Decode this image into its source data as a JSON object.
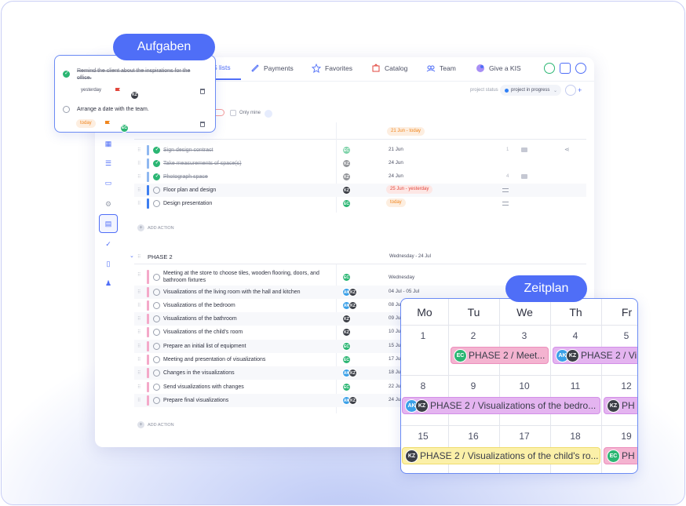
{
  "nav": {
    "items": [
      {
        "label": "S lists",
        "icon": "list-icon"
      },
      {
        "label": "Payments",
        "icon": "payments-icon"
      },
      {
        "label": "Favorites",
        "icon": "star-icon"
      },
      {
        "label": "Catalog",
        "icon": "catalog-icon"
      },
      {
        "label": "Team",
        "icon": "team-icon"
      },
      {
        "label": "Give a KIS",
        "icon": "kis-icon"
      }
    ]
  },
  "project": {
    "status_label": "project status",
    "status_value": "project in progress"
  },
  "filters": {
    "only_mine": "Only mine"
  },
  "phase1": {
    "header_date": "21 Jun - today",
    "rows": [
      {
        "title": "Sign design contract",
        "done": true,
        "avatars": [
          "EC"
        ],
        "date": "21 Jun",
        "bar": "#8fb8f0"
      },
      {
        "title": "Take measurements of space(s)",
        "done": true,
        "avatars": [
          "KZ"
        ],
        "date": "24 Jun",
        "bar": "#8fb8f0"
      },
      {
        "title": "Photograph space",
        "done": true,
        "avatars": [
          "KZ"
        ],
        "date": "24 Jun",
        "bar": "#8fb8f0"
      },
      {
        "title": "Floor plan and design",
        "done": false,
        "avatars": [
          "KZ"
        ],
        "date": "25 Jun - yesterday",
        "bar": "#3d7ef0"
      },
      {
        "title": "Design presentation",
        "done": false,
        "avatars": [
          "EC"
        ],
        "date": "today",
        "bar": "#3d7ef0"
      }
    ],
    "comment_counts": [
      "1",
      "4"
    ],
    "add_action": "ADD ACTION"
  },
  "phase2": {
    "name": "PHASE 2",
    "date": "Wednesday - 24 Jul",
    "rows": [
      {
        "title": "Meeting at the store to choose tiles, wooden flooring, doors, and bathroom fixtures",
        "avatars": [
          "EC"
        ],
        "date": "Wednesday"
      },
      {
        "title": "Visualizations of the living room with the hall and kitchen",
        "avatars": [
          "AK",
          "KZ"
        ],
        "date": "04 Jul - 05 Jul"
      },
      {
        "title": "Visualizations of the bedroom",
        "avatars": [
          "AK",
          "KZ"
        ],
        "date": "08 Ju"
      },
      {
        "title": "Visualizations of the bathroom",
        "avatars": [
          "KZ"
        ],
        "date": "09 Ju"
      },
      {
        "title": "Visualizations of the child's room",
        "avatars": [
          "KZ"
        ],
        "date": "10 Ju"
      },
      {
        "title": "Prepare an initial list of equipment",
        "avatars": [
          "EC"
        ],
        "date": "15 Ju"
      },
      {
        "title": "Meeting and presentation of visualizations",
        "avatars": [
          "EC"
        ],
        "date": "17 Ju"
      },
      {
        "title": "Changes in the visualizations",
        "avatars": [
          "AK",
          "KZ"
        ],
        "date": "18 Ju"
      },
      {
        "title": "Send visualizations with changes",
        "avatars": [
          "EC"
        ],
        "date": "22 Ju"
      },
      {
        "title": "Prepare final visualizations",
        "avatars": [
          "AK",
          "KZ"
        ],
        "date": "24 Ju"
      }
    ],
    "add_action": "ADD ACTION"
  },
  "tasks_panel": {
    "title": "Aufgaben",
    "tasks": [
      {
        "text": "Remind the client about the inspirations for the office.",
        "done": true,
        "due": "yesterday",
        "avatar": "KZ",
        "flag_color": "#e2463c"
      },
      {
        "text": "Arrange a date with the team.",
        "done": false,
        "due": "today",
        "avatar": "EC",
        "flag_color": "#f0861e"
      }
    ]
  },
  "calendar": {
    "title": "Zeitplan",
    "days": [
      "Mo",
      "Tu",
      "We",
      "Th",
      "Fr"
    ],
    "weeks": [
      [
        "1",
        "2",
        "3",
        "4",
        "5"
      ],
      [
        "8",
        "9",
        "10",
        "11",
        "12"
      ],
      [
        "15",
        "16",
        "17",
        "18",
        "19"
      ]
    ],
    "events": [
      {
        "label": "PHASE 2 / Meet...",
        "avatars": [
          "EC"
        ],
        "color": "pink"
      },
      {
        "label": "PHASE 2 / Vi",
        "avatars": [
          "AK",
          "KZ"
        ],
        "color": "purple"
      },
      {
        "label": "PHASE 2 / Visualizations of the bedro...",
        "avatars": [
          "AK",
          "KZ"
        ],
        "color": "purple"
      },
      {
        "label": "PH",
        "avatars": [
          "KZ"
        ],
        "color": "purple"
      },
      {
        "label": "PHASE 2 / Visualizations of the child's ro...",
        "avatars": [
          "KZ"
        ],
        "color": "yellow"
      },
      {
        "label": "PH",
        "avatars": [
          "EC"
        ],
        "color": "pink"
      }
    ]
  },
  "avatars": {
    "EC": "EC",
    "KZ": "KZ",
    "AK": "AK"
  }
}
